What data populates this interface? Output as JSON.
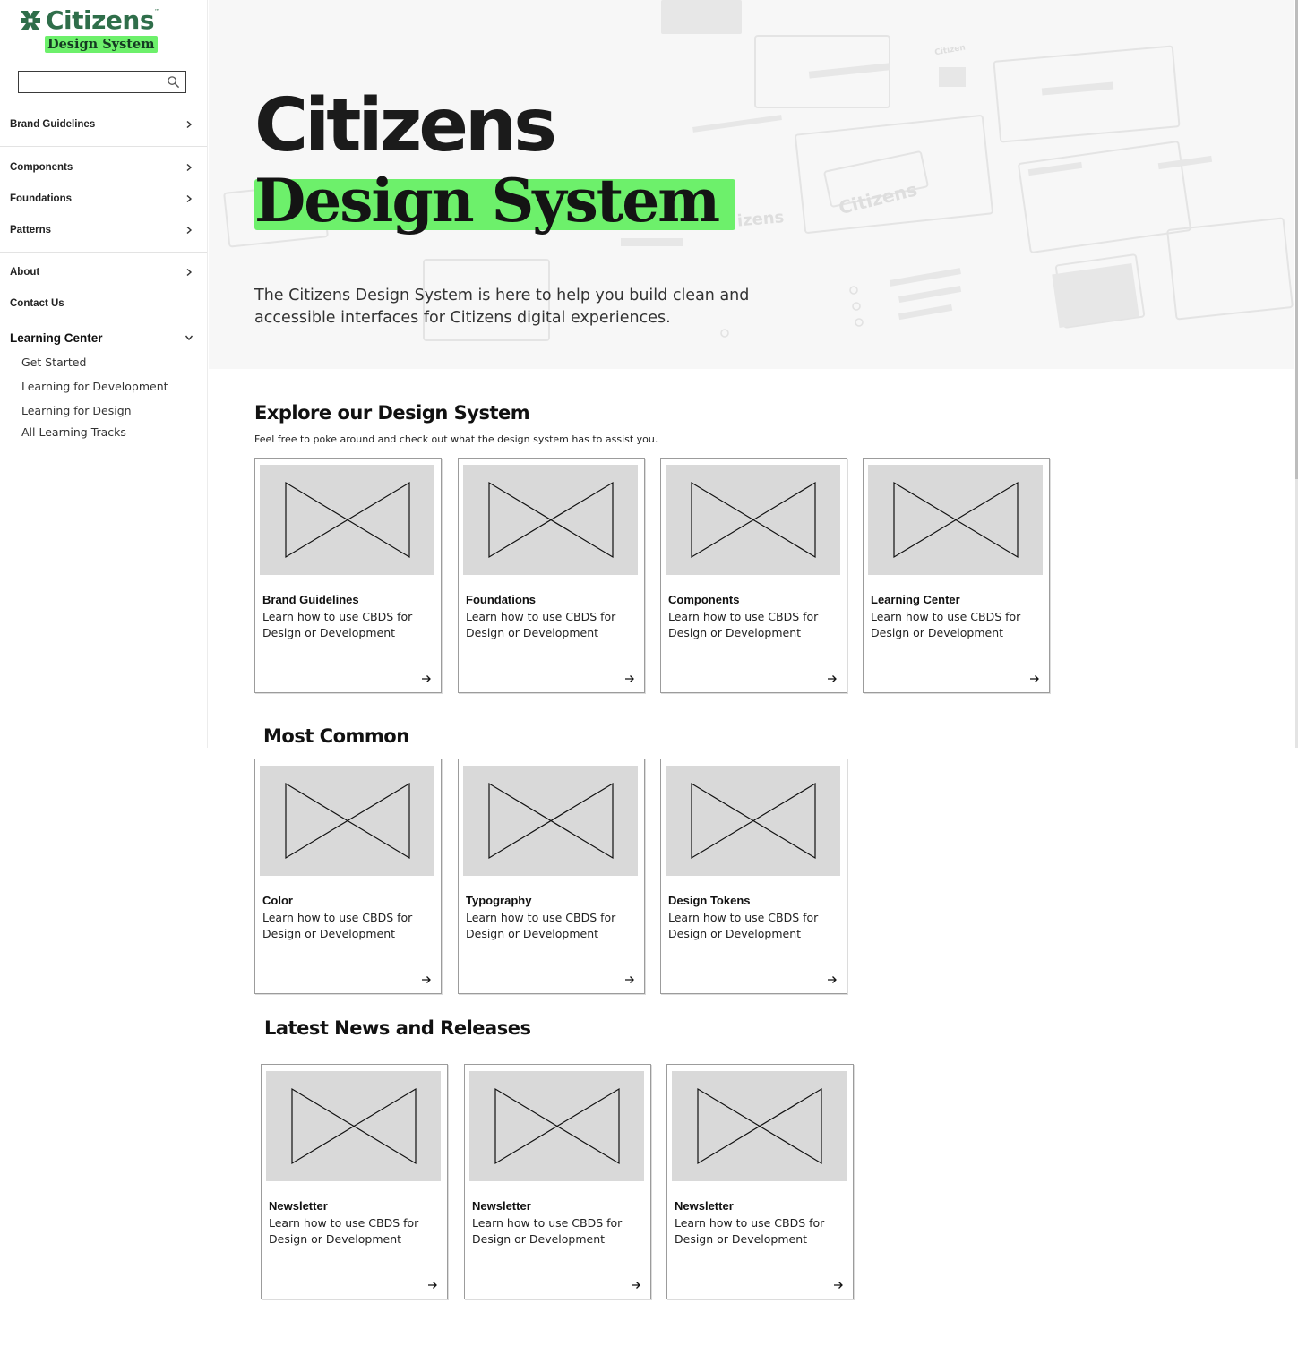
{
  "colors": {
    "brand_green": "#2f6e4a",
    "highlight_green": "#6df06b"
  },
  "logo": {
    "brand": "Citizens",
    "tm": "™",
    "tagline": "Design System"
  },
  "search": {
    "placeholder": "",
    "icon": "search-icon"
  },
  "sidebar": {
    "items": [
      {
        "label": "Brand Guidelines",
        "icon": "chevron-right-icon"
      },
      {
        "label": "Components",
        "icon": "chevron-right-icon"
      },
      {
        "label": "Foundations",
        "icon": "chevron-right-icon"
      },
      {
        "label": "Patterns",
        "icon": "chevron-right-icon"
      },
      {
        "label": "About",
        "icon": "chevron-right-icon"
      },
      {
        "label": "Contact Us"
      },
      {
        "label": "Learning Center",
        "icon": "chevron-down-icon",
        "expanded": true
      }
    ],
    "learning_sub": [
      "Get Started",
      "Learning for Development",
      "Learning for Design",
      "All Learning Tracks"
    ]
  },
  "hero": {
    "title_line1": "Citizens",
    "title_line2": "Design System",
    "description": "The Citizens Design System is here to help you build clean and accessible interfaces for Citizens digital experiences."
  },
  "explore": {
    "title": "Explore our Design System",
    "subtitle": "Feel free to poke around and check out what the design system has to assist you.",
    "cards": [
      {
        "title": "Brand Guidelines",
        "desc": "Learn how to use CBDS for Design or Development"
      },
      {
        "title": "Foundations",
        "desc": "Learn how to use CBDS for Design or Development"
      },
      {
        "title": "Components",
        "desc": "Learn how to use CBDS for Design or Development"
      },
      {
        "title": "Learning Center",
        "desc": "Learn how to use CBDS for Design or Development"
      }
    ]
  },
  "common": {
    "title": "Most Common",
    "cards": [
      {
        "title": "Color",
        "desc": "Learn how to use CBDS for Design or Development"
      },
      {
        "title": "Typography",
        "desc": "Learn how to use CBDS for Design or Development"
      },
      {
        "title": "Design Tokens",
        "desc": "Learn how to use CBDS for Design or Development"
      }
    ]
  },
  "news": {
    "title": "Latest News and Releases",
    "cards": [
      {
        "title": "Newsletter",
        "desc": "Learn how to use CBDS for Design or Development"
      },
      {
        "title": "Newsletter",
        "desc": "Learn how to use CBDS for Design or Development"
      },
      {
        "title": "Newsletter",
        "desc": "Learn how to use CBDS for Design or Development"
      }
    ]
  }
}
